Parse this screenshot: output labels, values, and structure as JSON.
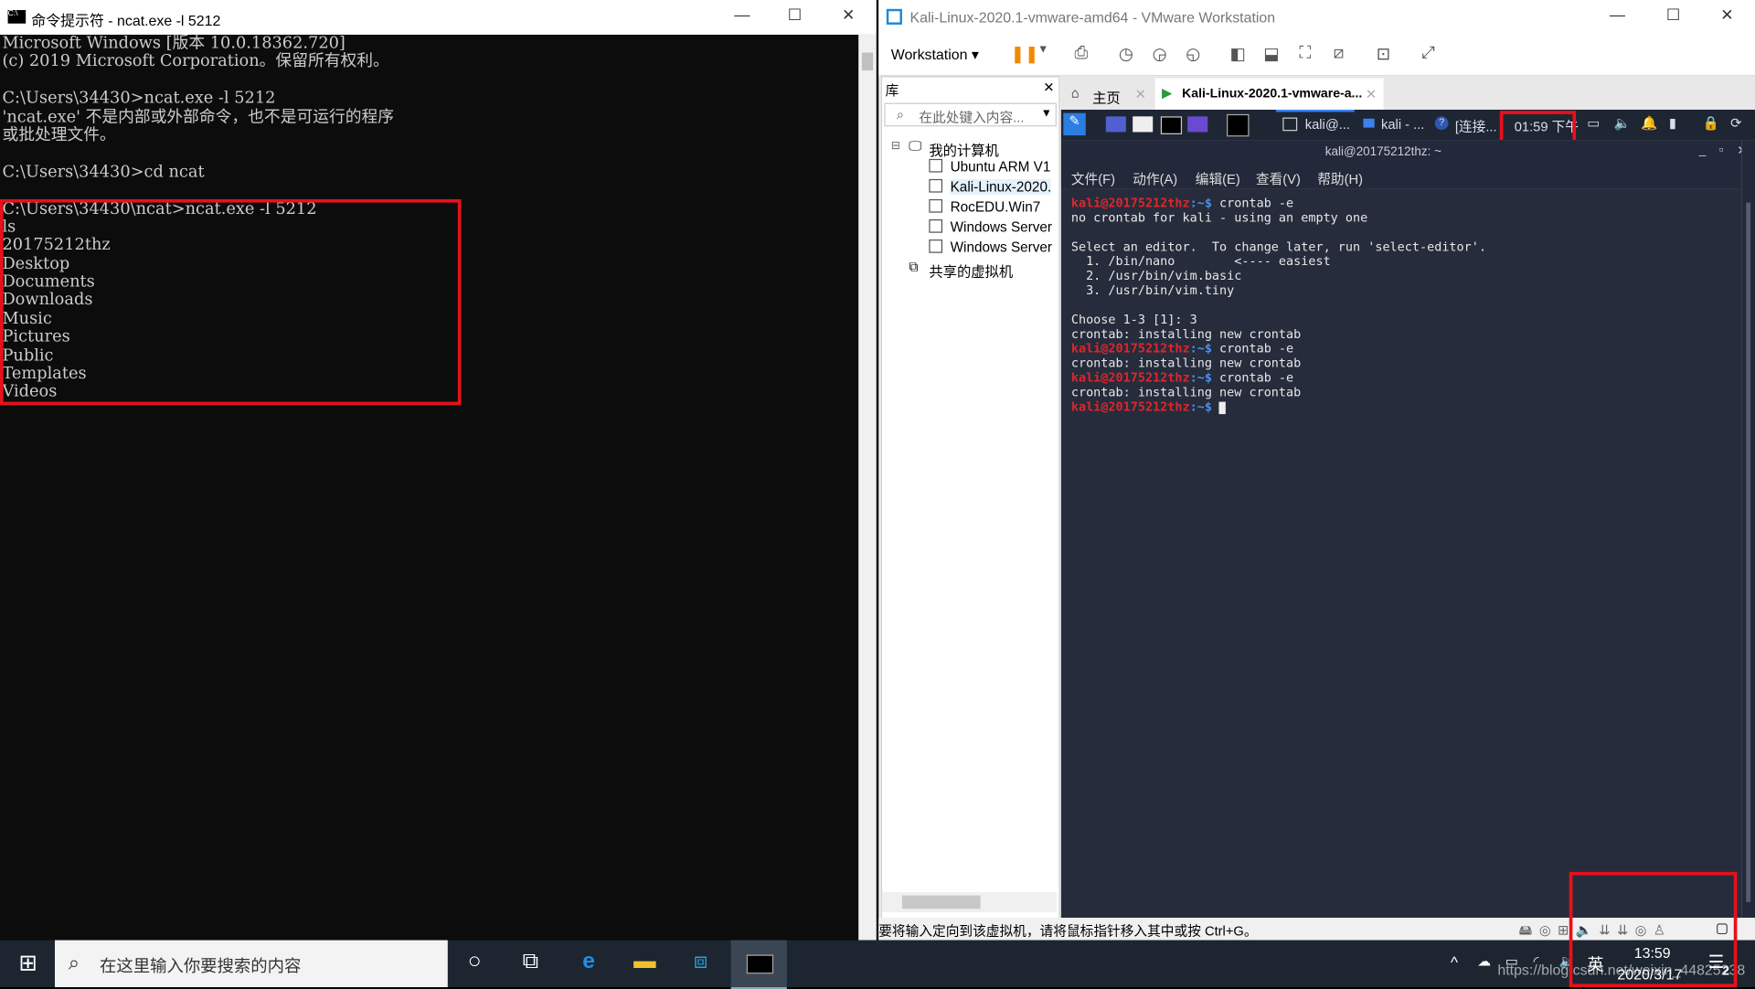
{
  "cmd": {
    "title": "命令提示符 - ncat.exe  -l 5212",
    "lines": [
      "Microsoft Windows [版本 10.0.18362.720]",
      "(c) 2019 Microsoft Corporation。保留所有权利。",
      "",
      "C:\\Users\\34430>ncat.exe -l 5212",
      "'ncat.exe' 不是内部或外部命令，也不是可运行的程序",
      "或批处理文件。",
      "",
      "C:\\Users\\34430>cd ncat",
      "",
      "C:\\Users\\34430\\ncat>ncat.exe -l 5212",
      "ls",
      "20175212thz",
      "Desktop",
      "Documents",
      "Downloads",
      "Music",
      "Pictures",
      "Public",
      "Templates",
      "Videos"
    ]
  },
  "vmware": {
    "title": "Kali-Linux-2020.1-vmware-amd64 - VMware Workstation",
    "workstation_menu": "Workstation",
    "library": {
      "title": "库",
      "search_placeholder": "在此处键入内容...",
      "root": "我的计算机",
      "items": [
        "Ubuntu ARM V1",
        "Kali-Linux-2020.",
        "RocEDU.Win7",
        "Windows Server",
        "Windows Server"
      ],
      "shared": "共享的虚拟机"
    },
    "tabs": [
      {
        "label": "主页"
      },
      {
        "label": "Kali-Linux-2020.1-vmware-a..."
      }
    ],
    "status": "要将输入定向到该虚拟机，请将鼠标指针移入其中或按 Ctrl+G。"
  },
  "kali": {
    "panel": {
      "task1": "kali@...",
      "task2": "kali - ...",
      "task3": "[连接...",
      "clock": "01:59 下午"
    },
    "term_title": "kali@20175212thz: ~",
    "menu": [
      "文件(F)",
      "动作(A)",
      "编辑(E)",
      "查看(V)",
      "帮助(H)"
    ],
    "prompt_user": "kali@20175212thz",
    "prompt_path": ":~$",
    "lines": [
      {
        "p": true,
        "t": " crontab -e"
      },
      {
        "t": "no crontab for kali - using an empty one"
      },
      {
        "t": ""
      },
      {
        "t": "Select an editor.  To change later, run 'select-editor'."
      },
      {
        "t": "  1. /bin/nano        <---- easiest"
      },
      {
        "t": "  2. /usr/bin/vim.basic"
      },
      {
        "t": "  3. /usr/bin/vim.tiny"
      },
      {
        "t": ""
      },
      {
        "t": "Choose 1-3 [1]: 3"
      },
      {
        "t": "crontab: installing new crontab"
      },
      {
        "p": true,
        "t": " crontab -e"
      },
      {
        "t": "crontab: installing new crontab"
      },
      {
        "p": true,
        "t": " crontab -e"
      },
      {
        "t": "crontab: installing new crontab"
      },
      {
        "p": true,
        "t": " "
      }
    ]
  },
  "taskbar": {
    "search_placeholder": "在这里输入你要搜索的内容",
    "ime": "英",
    "time": "13:59",
    "date": "2020/3/17",
    "notifications": "2",
    "watermark": "https://blog.csdn.net/weixin_44825238"
  },
  "colors": {
    "highlight": "#e8101a",
    "kali_prompt": "#e0252a",
    "kali_bg": "#262c3b"
  }
}
